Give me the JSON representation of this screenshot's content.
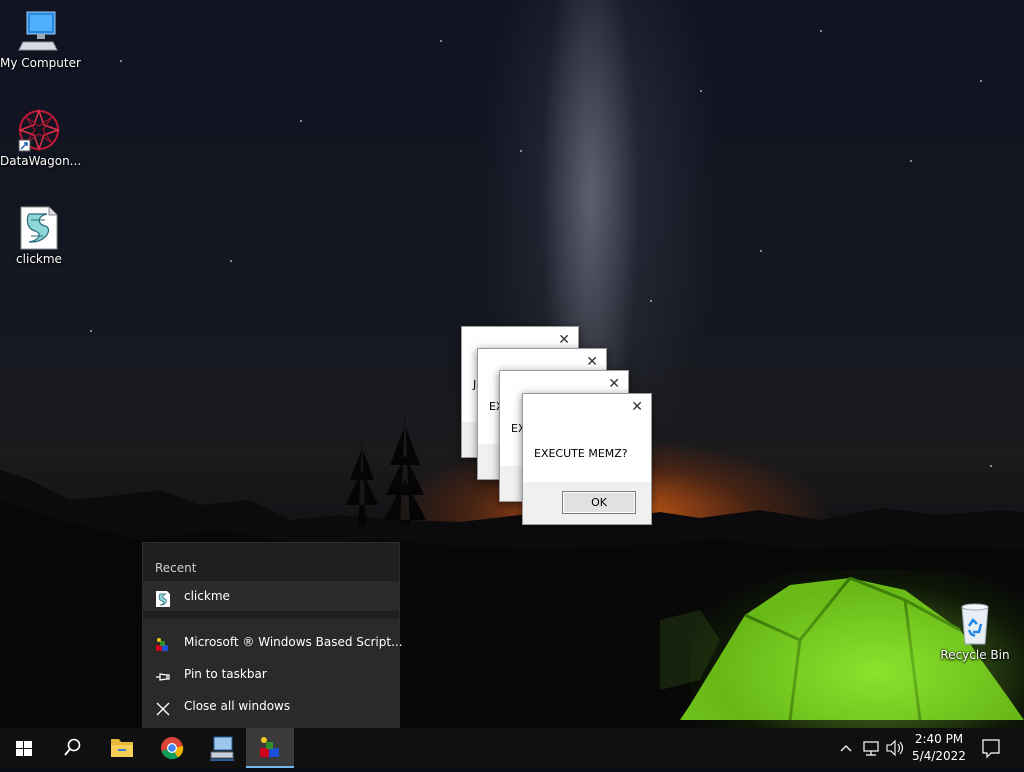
{
  "desktop_icons": [
    {
      "label": "My Computer",
      "icon": "computer-icon"
    },
    {
      "label": "DataWagon...",
      "icon": "datawagon-icon"
    },
    {
      "label": "clickme",
      "icon": "script-file-icon"
    },
    {
      "label": "Recycle Bin",
      "icon": "recycle-bin-icon"
    }
  ],
  "dialogs": [
    {
      "message": "JI",
      "close_glyph": "✕"
    },
    {
      "message": "EX",
      "close_glyph": "✕"
    },
    {
      "message": "EX",
      "close_glyph": "✕"
    },
    {
      "message": "EXECUTE MEMZ?",
      "close_glyph": "✕",
      "ok_label": "OK"
    }
  ],
  "jumplist": {
    "header": "Recent",
    "recent_items": [
      {
        "label": "clickme",
        "icon": "script-file-icon"
      }
    ],
    "tasks": [
      {
        "label": "Microsoft ® Windows Based Script...",
        "icon": "wscript-icon"
      },
      {
        "label": "Pin to taskbar",
        "icon": "pin-icon"
      },
      {
        "label": "Close all windows",
        "icon": "close-icon"
      }
    ]
  },
  "taskbar": {
    "buttons": [
      "start-button",
      "search-button",
      "file-explorer",
      "chrome",
      "network-app",
      "wscript-host"
    ],
    "clock_time": "2:40 PM",
    "clock_date": "5/4/2022",
    "tray_icons": [
      "chevron-up-icon",
      "network-icon",
      "volume-icon"
    ],
    "notification_icon": "action-center-icon"
  },
  "colors": {
    "accent": "#76b9ed",
    "taskbar": "#101010",
    "jumplist": "#1f1f1f",
    "tent": "#7ed321"
  }
}
